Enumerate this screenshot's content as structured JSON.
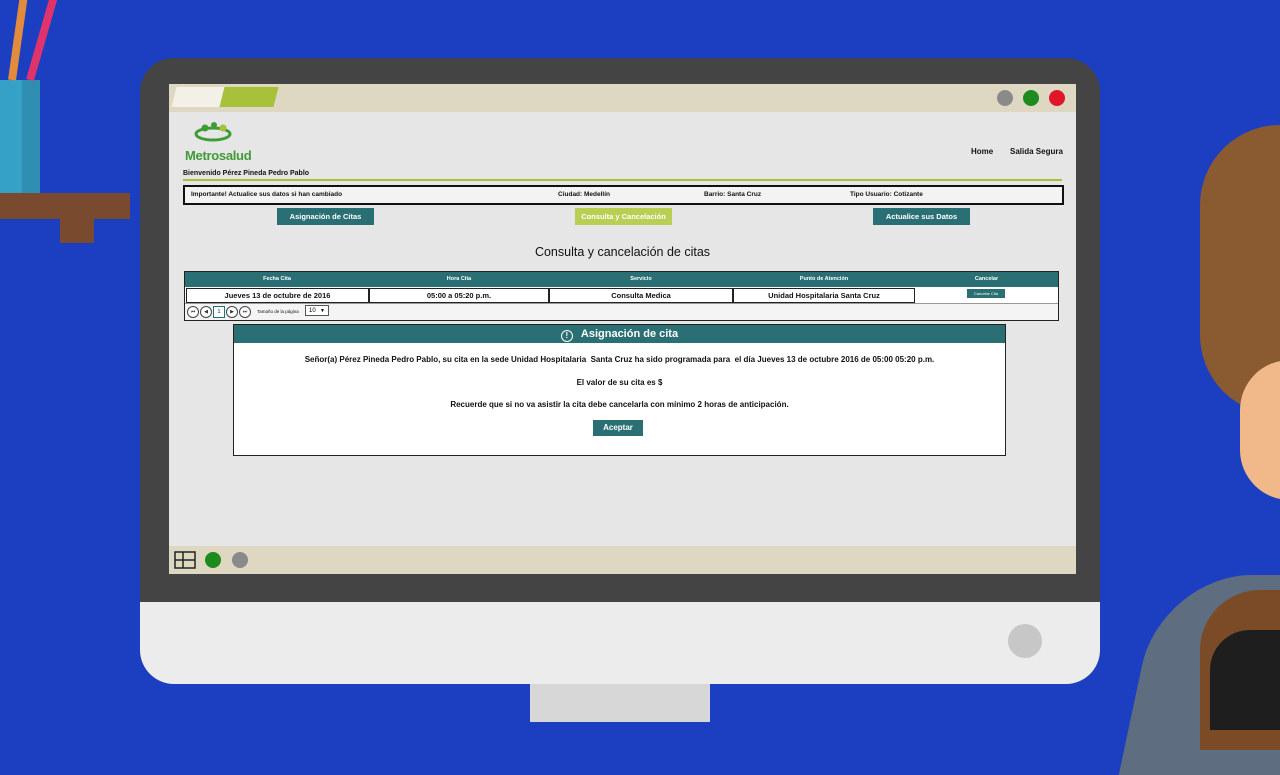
{
  "header": {
    "logo_text": "Metrosalud",
    "nav": {
      "home": "Home",
      "logout": "Salida Segura"
    },
    "welcome": "Bienvenido Pérez Pineda Pedro Pablo"
  },
  "info_bar": {
    "notice": "Importante! Actualice sus datos si han cambiado",
    "city": "Ciudad: Medellín",
    "neighborhood": "Barrio: Santa Cruz",
    "user_type": "Tipo Usuario: Cotizante"
  },
  "menu": {
    "assign": "Asignación de Citas",
    "consult": "Consulta y Cancelación",
    "update": "Actualice sus Datos"
  },
  "page_title": "Consulta y cancelación de citas",
  "table": {
    "headers": [
      "Fecha Cita",
      "Hora Cita",
      "Servicio",
      "Punto de Atención",
      "Cancelar"
    ],
    "rows": [
      {
        "date": "Jueves 13 de octubre de 2016",
        "time": "05:00 a 05:20 p.m.",
        "service": "Consulta Medica",
        "location": "Unidad Hospitalaria Santa Cruz",
        "cancel": "Cancelar Cita"
      }
    ],
    "pager": {
      "current_page": "1",
      "page_size_label": "Tamaño de la página",
      "page_size": "10"
    }
  },
  "modal": {
    "title": "Asignación de cita",
    "line1": "Señor(a) Pérez Pineda Pedro Pablo, su cita en la sede Unidad Hospitalaria  Santa Cruz ha sido programada para  el día Jueves 13 de octubre 2016 de 05:00 05:20 p.m.",
    "line2": "El valor de su cita es $",
    "line3": "Recuerde que si no va asistir la cita debe cancelarla con mínimo 2 horas de anticipación.",
    "accept": "Aceptar"
  },
  "colors": {
    "teal": "#2a6f73",
    "lime": "#b9cf53",
    "background": "#1c3fc1"
  }
}
